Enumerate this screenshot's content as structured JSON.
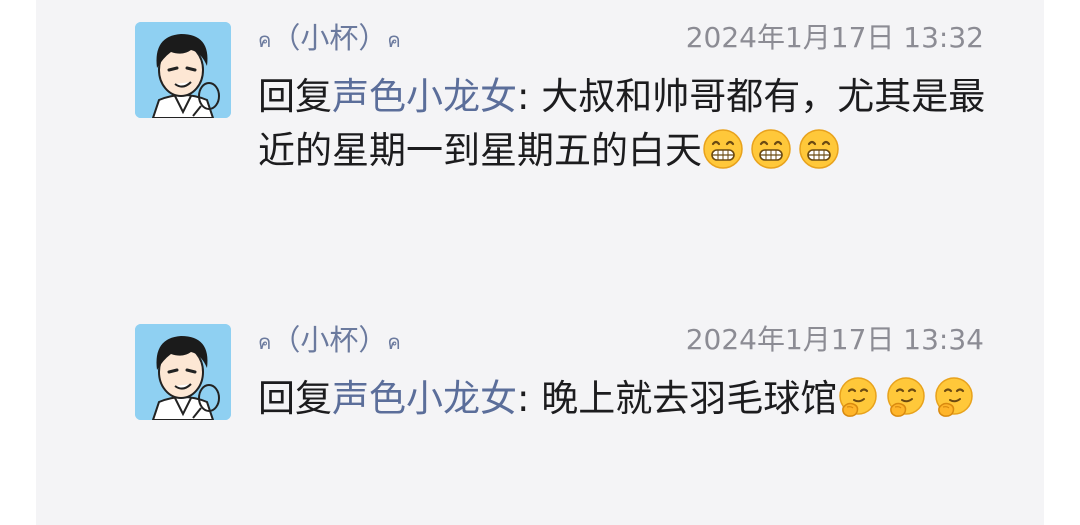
{
  "comments": [
    {
      "author": "（小杯）",
      "author_deco_left": "ค",
      "author_deco_right": "ค",
      "timestamp": "2024年1月17日 13:32",
      "reply_prefix": "回复",
      "reply_target": "声色小龙女",
      "separator": ": ",
      "text": "大叔和帅哥都有，尤其是最近的星期一到星期五的白天",
      "emojis": [
        "grin-teeth-emoji",
        "grin-teeth-emoji",
        "grin-teeth-emoji"
      ]
    },
    {
      "author": "（小杯）",
      "author_deco_left": "ค",
      "author_deco_right": "ค",
      "timestamp": "2024年1月17日 13:34",
      "reply_prefix": "回复",
      "reply_target": "声色小龙女",
      "separator": ": ",
      "text": "晚上就去羽毛球馆",
      "emojis": [
        "thinking-smirk-emoji",
        "thinking-smirk-emoji",
        "thinking-smirk-emoji"
      ]
    }
  ],
  "colors": {
    "panel_bg": "#f4f4f6",
    "author": "#6b7a9e",
    "reply_target": "#5b6e9a",
    "timestamp": "#8c8c94",
    "text": "#1c1c1e",
    "avatar_bg": "#8fd0f2"
  }
}
